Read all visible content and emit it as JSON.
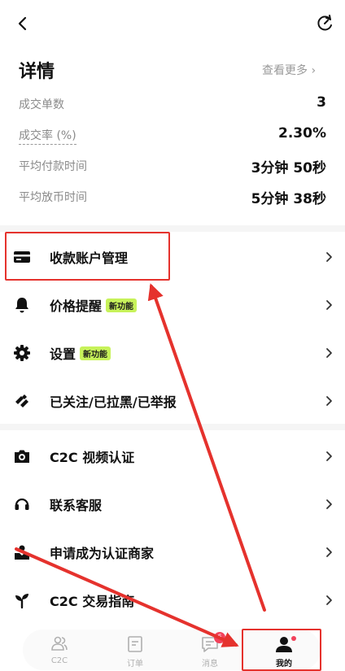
{
  "details": {
    "title": "详情",
    "more_link": "查看更多 ›",
    "stats": [
      {
        "label": "成交单数",
        "value": "3"
      },
      {
        "label": "成交率 (%)",
        "value": "2.30%"
      },
      {
        "label": "平均付款时间",
        "value": "3分钟 50秒"
      },
      {
        "label": "平均放币时间",
        "value": "5分钟 38秒"
      }
    ]
  },
  "menu": {
    "items": [
      {
        "label": "收款账户管理",
        "icon": "card-icon"
      },
      {
        "label": "价格提醒",
        "badge": "新功能",
        "icon": "bell-icon"
      },
      {
        "label": "设置",
        "badge": "新功能",
        "icon": "gear-icon"
      },
      {
        "label": "已关注/已拉黑/已举报",
        "icon": "tag-icon"
      },
      {
        "label": "C2C 视频认证",
        "icon": "camera-icon"
      },
      {
        "label": "联系客服",
        "icon": "headset-icon"
      },
      {
        "label": "申请成为认证商家",
        "icon": "merchant-icon"
      },
      {
        "label": "C2C 交易指南",
        "icon": "sprout-icon"
      }
    ]
  },
  "tabbar": {
    "tabs": [
      {
        "label": "C2C",
        "icon": "people-icon"
      },
      {
        "label": "订单",
        "icon": "order-icon"
      },
      {
        "label": "消息",
        "icon": "message-icon",
        "badge": "6"
      },
      {
        "label": "我的",
        "icon": "person-icon",
        "active": true
      }
    ]
  },
  "colors": {
    "accent_badge": "#c7f25a",
    "annotation_red": "#e5322d",
    "notification_red": "#f2415a",
    "muted_text": "#8a8a8a"
  }
}
